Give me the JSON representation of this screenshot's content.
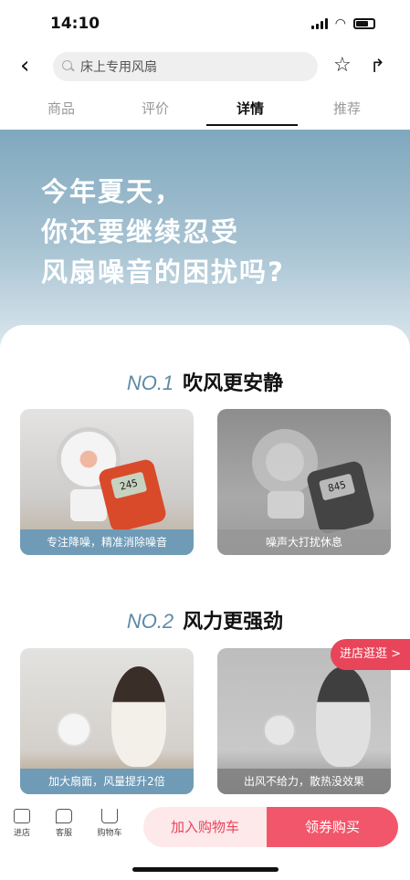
{
  "status_bar": {
    "time": "14:10"
  },
  "nav": {
    "back_glyph": "‹",
    "search_query": "床上专用风扇",
    "star_glyph": "☆",
    "share_glyph": "↱"
  },
  "tabs": [
    {
      "label": "商品",
      "active": false
    },
    {
      "label": "评价",
      "active": false
    },
    {
      "label": "详情",
      "active": true
    },
    {
      "label": "推荐",
      "active": false
    }
  ],
  "hero": {
    "lines": [
      "今年夏天，",
      "你还要继续忍受",
      "风扇噪音的困扰吗?"
    ]
  },
  "sections": [
    {
      "no": "NO.1",
      "title": "吹风更安静",
      "images": [
        {
          "caption": "专注降噪，精准消除噪音",
          "meter_reading": "245"
        },
        {
          "caption": "噪声大打扰休息",
          "meter_reading": "845"
        }
      ]
    },
    {
      "no": "NO.2",
      "title": "风力更强劲",
      "images": [
        {
          "caption": "加大扇面，风量提升2倍"
        },
        {
          "caption": "出风不给力，散热没效果"
        }
      ]
    }
  ],
  "promo": {
    "label": "进店逛逛 >"
  },
  "bottom_bar": {
    "items": [
      {
        "label": "进店",
        "icon": "store-icon"
      },
      {
        "label": "客服",
        "icon": "chat-icon"
      },
      {
        "label": "购物车",
        "icon": "cart-icon"
      }
    ],
    "add_to_cart": "加入购物车",
    "buy": "领券购买"
  },
  "colors": {
    "accent": "#e8455a",
    "hero_blue": "#7fa8be",
    "section_blue": "#5e8aa8"
  }
}
